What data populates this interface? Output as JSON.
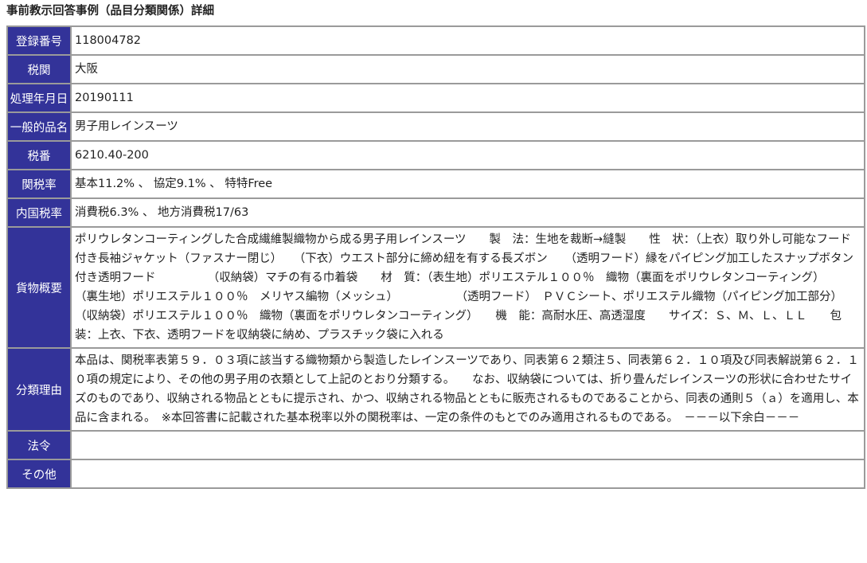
{
  "page": {
    "title": "事前教示回答事例（品目分類関係）詳細"
  },
  "colors": {
    "header_cell_bg": "#333399",
    "header_cell_text": "#ffffff",
    "border": "#9a9a9a"
  },
  "rows": [
    {
      "label": "登録番号",
      "value": "118004782"
    },
    {
      "label": "税関",
      "value": "大阪"
    },
    {
      "label": "処理年月日",
      "value": "20190111"
    },
    {
      "label": "一般的品名",
      "value": "男子用レインスーツ"
    },
    {
      "label": "税番",
      "value": "6210.40-200"
    },
    {
      "label": "関税率",
      "value": "基本11.2% 、 協定9.1% 、 特特Free"
    },
    {
      "label": "内国税率",
      "value": "消費税6.3% 、 地方消費税17/63"
    },
    {
      "label": "貨物概要",
      "value": "ポリウレタンコーティングした合成繊維製織物から成る男子用レインスーツ　　製　法：生地を裁断→縫製　　性　状：（上衣）取り外し可能なフード付き長袖ジャケット（ファスナー閉じ）　　（下衣）ウエスト部分に締め紐を有する長ズボン　　（透明フード）縁をパイピング加工したスナップボタン付き透明フード　　　　　（収納袋）マチの有る巾着袋　　材　質：（表生地）ポリエステル１００％　織物（裏面をポリウレタンコーティング）　　　　　（裏生地）ポリエステル１００％　メリヤス編物（メッシュ）　　　　　　（透明フード）　ＰＶＣシート、ポリエステル織物（パイピング加工部分）　　（収納袋）ポリエステル１００％　織物（裏面をポリウレタンコーティング）　　機　能：高耐水圧、高透湿度　　サイズ：Ｓ、Ｍ、Ｌ、ＬＬ　　包　装：上衣、下衣、透明フードを収納袋に納め、プラスチック袋に入れる"
    },
    {
      "label": "分類理由",
      "value": "本品は、関税率表第５９．０３項に該当する織物類から製造したレインスーツであり、同表第６２類注５、同表第６２．１０項及び同表解説第６２．１０項の規定により、その他の男子用の衣類として上記のとおり分類する。　　なお、収納袋については、折り畳んだレインスーツの形状に合わせたサイズのものであり、収納される物品とともに提示され、かつ、収納される物品とともに販売されるものであることから、同表の通則５（ａ）を適用し、本品に含まれる。　※本回答書に記載された基本税率以外の関税率は、一定の条件のもとでのみ適用されるものである。　－－－以下余白－－－"
    },
    {
      "label": "法令",
      "value": ""
    },
    {
      "label": "その他",
      "value": ""
    }
  ]
}
